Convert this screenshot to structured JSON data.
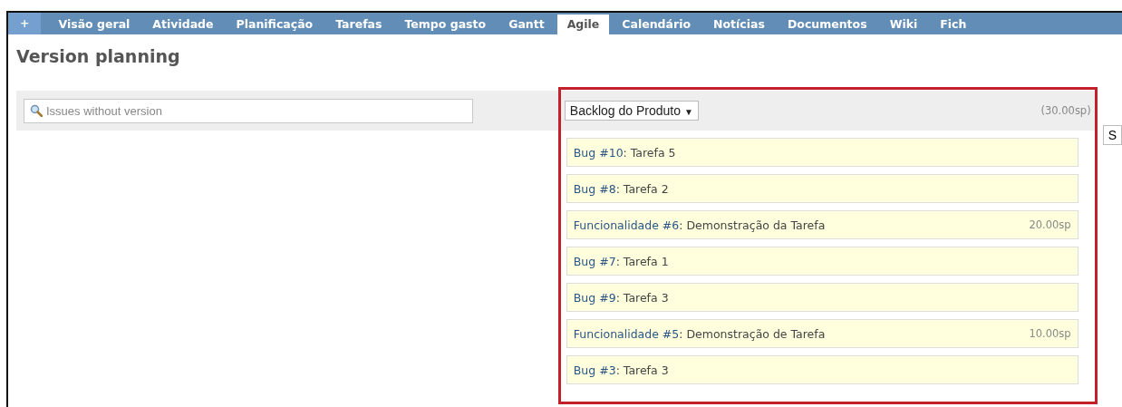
{
  "tabs": [
    {
      "label": "+",
      "selected": false
    },
    {
      "label": "Visão geral",
      "selected": false
    },
    {
      "label": "Atividade",
      "selected": false
    },
    {
      "label": "Planificação",
      "selected": false
    },
    {
      "label": "Tarefas",
      "selected": false
    },
    {
      "label": "Tempo gasto",
      "selected": false
    },
    {
      "label": "Gantt",
      "selected": false
    },
    {
      "label": "Agile",
      "selected": true
    },
    {
      "label": "Calendário",
      "selected": false
    },
    {
      "label": "Notícias",
      "selected": false
    },
    {
      "label": "Documentos",
      "selected": false
    },
    {
      "label": "Wiki",
      "selected": false
    },
    {
      "label": "Fich",
      "selected": false
    }
  ],
  "page_title": "Version planning",
  "search": {
    "placeholder": "Issues without version"
  },
  "version_select": {
    "value": "Backlog do Produto",
    "caret": "▼"
  },
  "total_points": "(30.00sp)",
  "next_select": {
    "value": "S"
  },
  "issues": [
    {
      "link": "Bug #10",
      "text": ": Tarefa 5"
    },
    {
      "link": "Bug #8",
      "text": ": Tarefa 2"
    },
    {
      "link": "Funcionalidade #6",
      "text": ": Demonstração da Tarefa",
      "points": "20.00sp"
    },
    {
      "link": "Bug #7",
      "text": ": Tarefa 1"
    },
    {
      "link": "Bug #9",
      "text": ": Tarefa 3"
    },
    {
      "link": "Funcionalidade #5",
      "text": ": Demonstração de Tarefa",
      "points": "10.00sp"
    },
    {
      "link": "Bug #3",
      "text": ": Tarefa 3"
    }
  ]
}
